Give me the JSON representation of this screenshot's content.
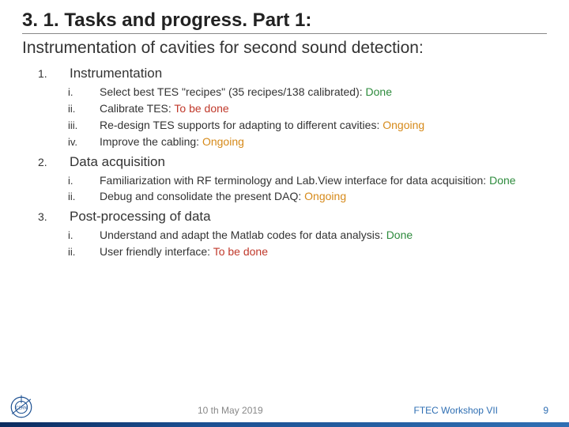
{
  "title": "3. 1. Tasks and progress. Part 1:",
  "subtitle": "Instrumentation of cavities for second sound detection:",
  "sections": [
    {
      "num": "1.",
      "label": "Instrumentation",
      "items": [
        {
          "num": "i.",
          "text": "Select best TES \"recipes\" (35 recipes/138 calibrated): ",
          "status_text": "Done",
          "status": "done"
        },
        {
          "num": "ii.",
          "text": "Calibrate TES: ",
          "status_text": "To be done",
          "status": "todo"
        },
        {
          "num": "iii.",
          "text": "Re-design TES supports for adapting to different cavities: ",
          "status_text": "Ongoing",
          "status": "ongoing"
        },
        {
          "num": "iv.",
          "text": "Improve the cabling: ",
          "status_text": "Ongoing",
          "status": "ongoing"
        }
      ]
    },
    {
      "num": "2.",
      "label": "Data acquisition",
      "items": [
        {
          "num": "i.",
          "text": "Familiarization with RF terminology and Lab.View interface for data acquisition: ",
          "status_text": "Done",
          "status": "done"
        },
        {
          "num": "ii.",
          "text": "Debug and consolidate the present DAQ: ",
          "status_text": "Ongoing",
          "status": "ongoing"
        }
      ]
    },
    {
      "num": "3.",
      "label": "Post-processing of data",
      "items": [
        {
          "num": "i.",
          "text": "Understand and adapt the Matlab codes for data analysis: ",
          "status_text": "Done",
          "status": "done"
        },
        {
          "num": "ii.",
          "text": "User friendly interface: ",
          "status_text": "To be done",
          "status": "todo"
        }
      ]
    }
  ],
  "footer": {
    "date": "10 th May 2019",
    "event": "FTEC Workshop VII",
    "page": "9"
  },
  "logo_label": "CERN"
}
